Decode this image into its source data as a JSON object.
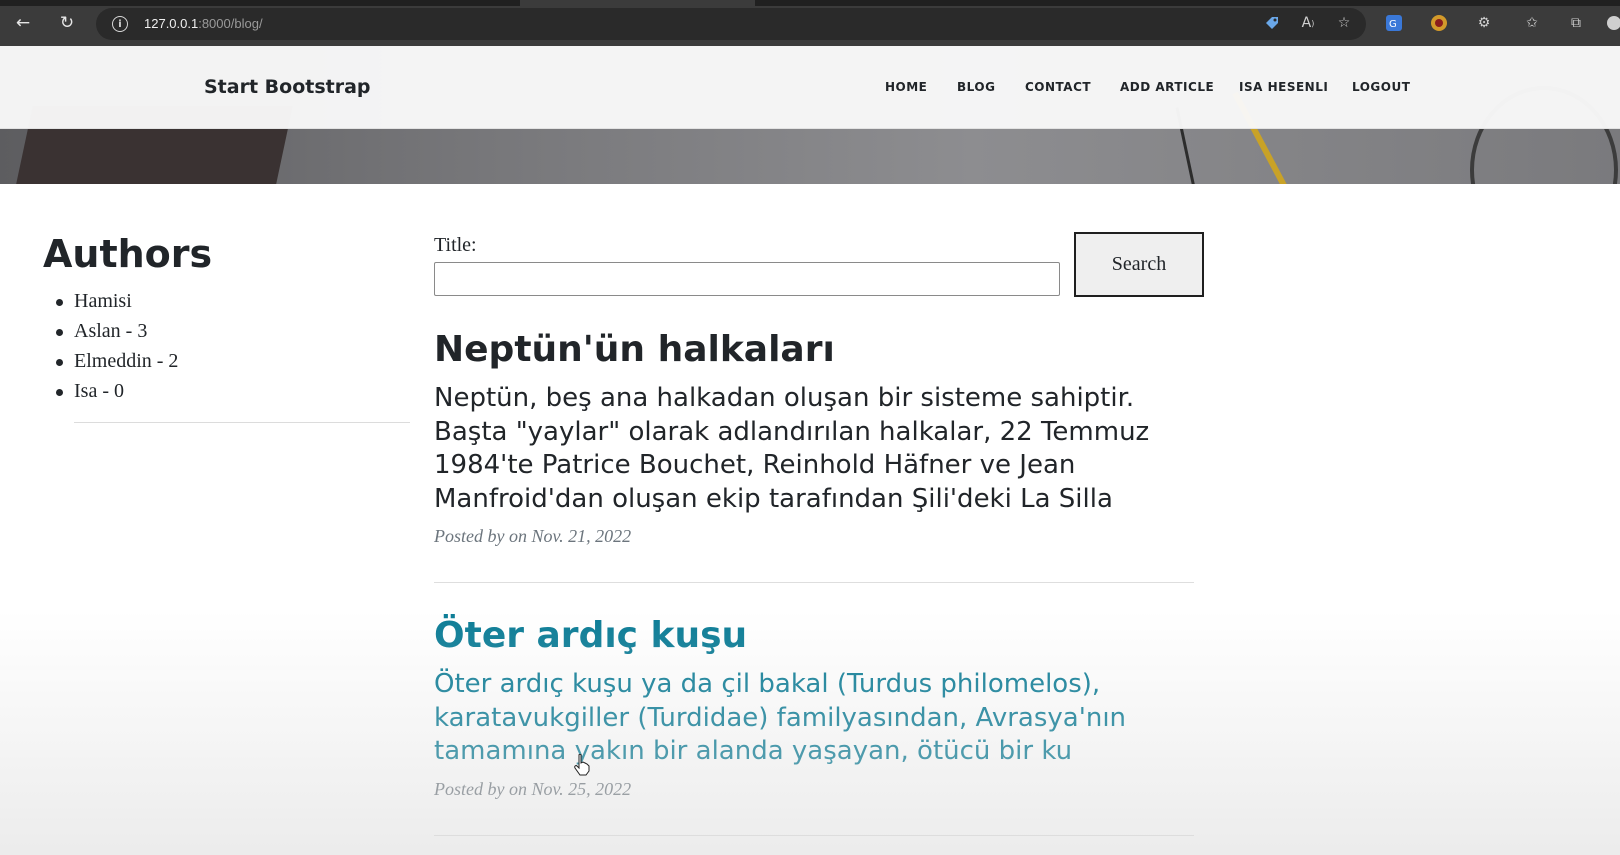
{
  "browser": {
    "url_host": "127.0.0.1",
    "url_path": ":8000/blog/",
    "info_icon": "i"
  },
  "navbar": {
    "brand": "Start Bootstrap",
    "links": [
      "HOME",
      "BLOG",
      "CONTACT",
      "ADD ARTICLE",
      "ISA HESENLI",
      "LOGOUT"
    ]
  },
  "sidebar": {
    "title": "Authors",
    "authors": [
      "Hamisi",
      "Aslan - 3",
      "Elmeddin - 2",
      "Isa - 0"
    ]
  },
  "search": {
    "label": "Title:",
    "value": "",
    "button": "Search"
  },
  "posts": [
    {
      "title": "Neptün'ün halkaları",
      "excerpt": "Neptün, beş ana halkadan oluşan bir sisteme sahiptir. Başta \"yaylar\" olarak adlandırılan halkalar, 22 Temmuz 1984'te Patrice Bouchet, Reinhold Häfner ve Jean Manfroid'dan oluşan ekip tarafından Şili'deki La Silla",
      "meta": "Posted by on Nov. 21, 2022"
    },
    {
      "title": "Öter ardıç kuşu",
      "excerpt": "Öter ardıç kuşu ya da çil bakal (Turdus philomelos), karatavukgiller (Turdidae) familyasından, Avrasya'nın tamamına yakın bir alanda yaşayan, ötücü bir ku",
      "meta": "Posted by on Nov. 25, 2022"
    }
  ],
  "colors": {
    "link_hover": "#0b7c96",
    "text": "#212529",
    "muted": "#6c757d"
  }
}
